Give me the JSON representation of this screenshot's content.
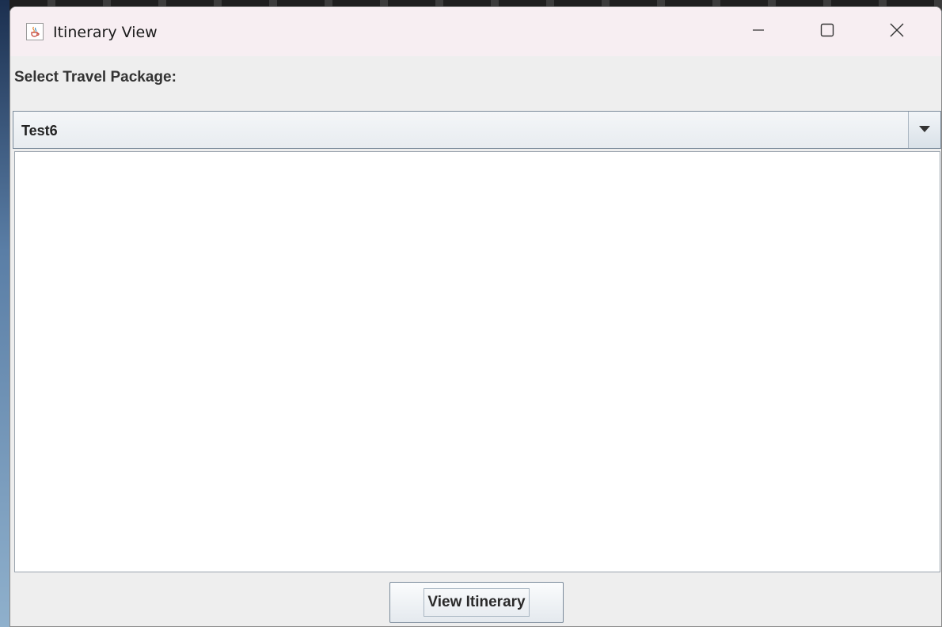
{
  "window": {
    "title": "Itinerary View",
    "icon": "java-cup-icon"
  },
  "titlebar_buttons": {
    "minimize": "minimize-icon",
    "maximize": "maximize-icon",
    "close": "close-icon"
  },
  "form": {
    "select_label": "Select Travel Package:",
    "package_combo": {
      "selected_value": "Test6"
    },
    "view_button_label": "View Itinerary"
  },
  "colors": {
    "titlebar_bg": "#f7eef2",
    "window_bg": "#eeeeee",
    "content_bg": "#ffffff"
  }
}
